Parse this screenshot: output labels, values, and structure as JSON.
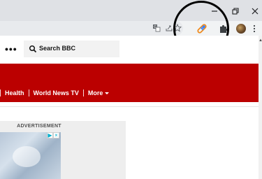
{
  "browser": {
    "icons": {
      "window_minimize": "minimize-icon",
      "window_restore": "restore-icon",
      "window_close": "close-icon",
      "translate": "translate-icon",
      "share": "share-icon",
      "bookmark": "star-icon",
      "extension_pinned": "link-pen-icon",
      "extensions": "puzzle-icon",
      "profile": "avatar",
      "menu": "kebab-menu-icon"
    }
  },
  "header": {
    "search": {
      "label": "Search BBC"
    }
  },
  "nav": {
    "items": [
      {
        "label": "Health"
      },
      {
        "label": "World News TV"
      }
    ],
    "more": {
      "label": "More"
    }
  },
  "advertisement": {
    "label": "ADVERTISEMENT"
  },
  "colors": {
    "bbc_red": "#bb0000",
    "chrome_frame": "#dfe1e5",
    "highlight_circle": "#000000"
  }
}
